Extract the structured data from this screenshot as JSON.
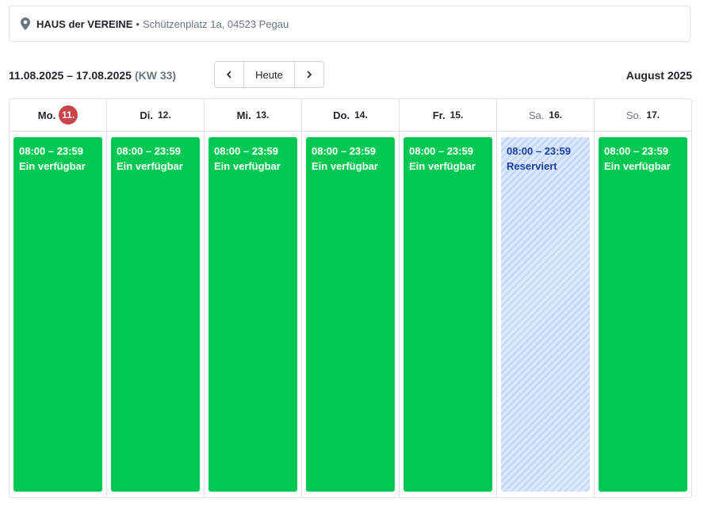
{
  "location": {
    "icon": "map-pin-icon",
    "venue": "HAUS der VEREINE",
    "separator": "•",
    "address": "Schützenplatz 1a, 04523 Pegau"
  },
  "toolbar": {
    "range": "11.08.2025 – 17.08.2025",
    "week": "(KW 33)",
    "prev_icon": "chevron-left-icon",
    "today_label": "Heute",
    "next_icon": "chevron-right-icon",
    "month": "August 2025"
  },
  "days": [
    {
      "name": "Mo.",
      "num": "11.",
      "today": true,
      "weekend": false,
      "event": {
        "time": "08:00 – 23:59",
        "status": "Ein verfügbar",
        "state": "available"
      }
    },
    {
      "name": "Di.",
      "num": "12.",
      "today": false,
      "weekend": false,
      "event": {
        "time": "08:00 – 23:59",
        "status": "Ein verfügbar",
        "state": "available"
      }
    },
    {
      "name": "Mi.",
      "num": "13.",
      "today": false,
      "weekend": false,
      "event": {
        "time": "08:00 – 23:59",
        "status": "Ein verfügbar",
        "state": "available"
      }
    },
    {
      "name": "Do.",
      "num": "14.",
      "today": false,
      "weekend": false,
      "event": {
        "time": "08:00 – 23:59",
        "status": "Ein verfügbar",
        "state": "available"
      }
    },
    {
      "name": "Fr.",
      "num": "15.",
      "today": false,
      "weekend": false,
      "event": {
        "time": "08:00 – 23:59",
        "status": "Ein verfügbar",
        "state": "available"
      }
    },
    {
      "name": "Sa.",
      "num": "16.",
      "today": false,
      "weekend": true,
      "event": {
        "time": "08:00 – 23:59",
        "status": "Reserviert",
        "state": "reserved"
      }
    },
    {
      "name": "So.",
      "num": "17.",
      "today": false,
      "weekend": true,
      "event": {
        "time": "08:00 – 23:59",
        "status": "Ein verfügbar",
        "state": "available"
      }
    }
  ],
  "colors": {
    "available": "#00c853",
    "reserved_bg": "#dbe7fb",
    "reserved_text": "#1a3fa0",
    "today_badge": "#c9444b"
  }
}
